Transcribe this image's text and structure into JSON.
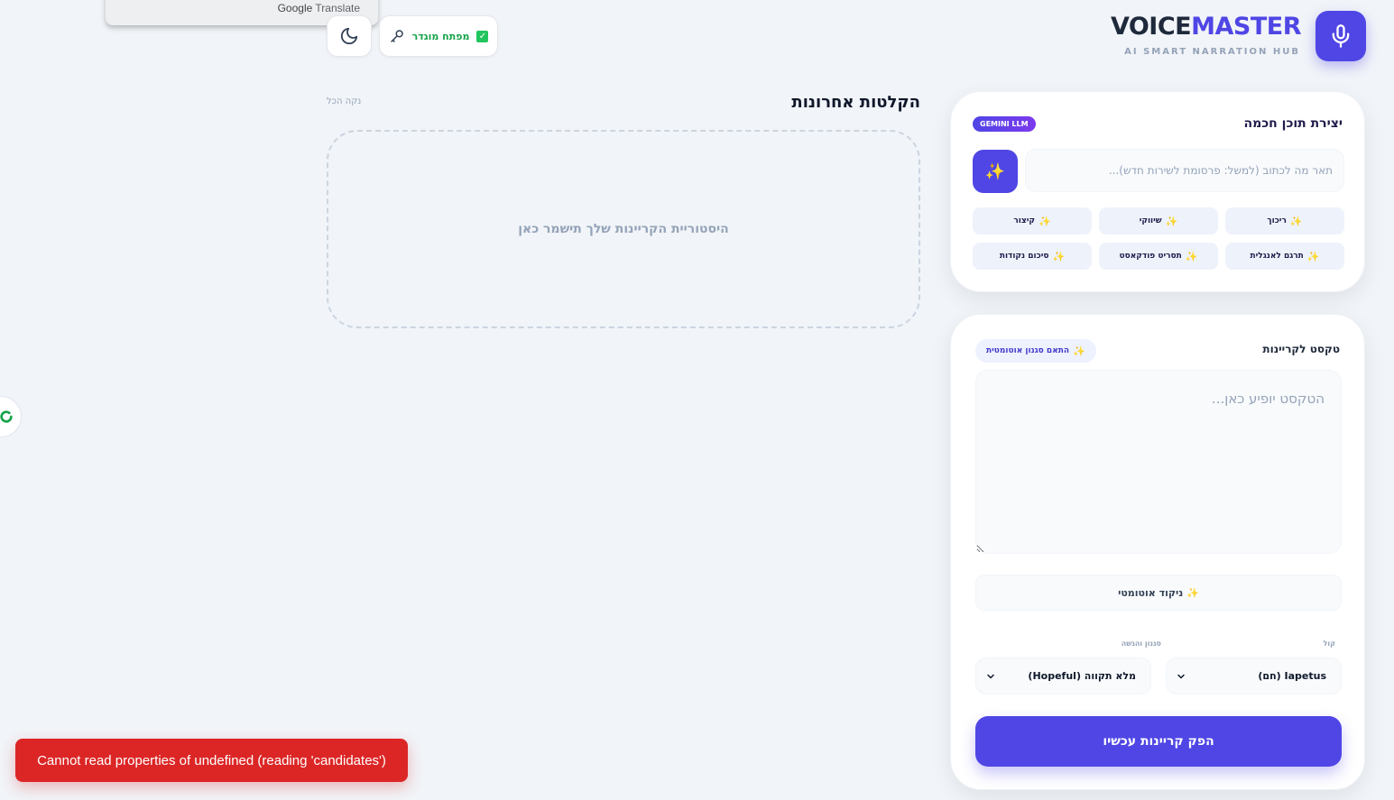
{
  "google_translate": {
    "brand": "Google",
    "label": "Translate"
  },
  "header": {
    "title_part1": "VOICE",
    "title_part2": "MASTER",
    "subtitle": "AI SMART NARRATION HUB",
    "key_button_label": "מפתח מוגדר",
    "mic_icon": "mic-icon",
    "moon_icon": "moon-icon",
    "key_icon": "key-icon"
  },
  "history": {
    "title": "הקלטות אחרונות",
    "clear_all": "נקה הכל",
    "empty_message": "היסטוריית הקריינות שלך תישמר כאן"
  },
  "ai_card": {
    "title": "יצירת תוכן חכמה",
    "badge": "GEMINI LLM",
    "prompt_placeholder": "תאר מה לכתוב (למשל: פרסומת לשירות חדש)...",
    "chips": [
      {
        "label": "ריכוך"
      },
      {
        "label": "שיווקי"
      },
      {
        "label": "קיצור"
      },
      {
        "label": "תרגם לאנגלית"
      },
      {
        "label": "תסריט פודקאסט"
      },
      {
        "label": "סיכום נקודות"
      }
    ]
  },
  "text_card": {
    "label": "טקסט לקריינות",
    "auto_style": "התאם סגנון אוטומטית",
    "text_placeholder": "הטקסט יופיע כאן...",
    "nikud_button": "ניקוד אוטומטי",
    "voice_label": "קול",
    "voice_value": "Iapetus (חם)",
    "style_label": "סגנון והגשה",
    "style_value": "מלא תקווה (Hopeful)",
    "produce_button": "הפק קריינות עכשיו"
  },
  "toast": {
    "message": "Cannot read properties of undefined (reading 'candidates')"
  },
  "colors": {
    "accent": "#4f46e5",
    "error": "#dc2626",
    "success": "#16a34a",
    "background": "#f1f4f8"
  }
}
